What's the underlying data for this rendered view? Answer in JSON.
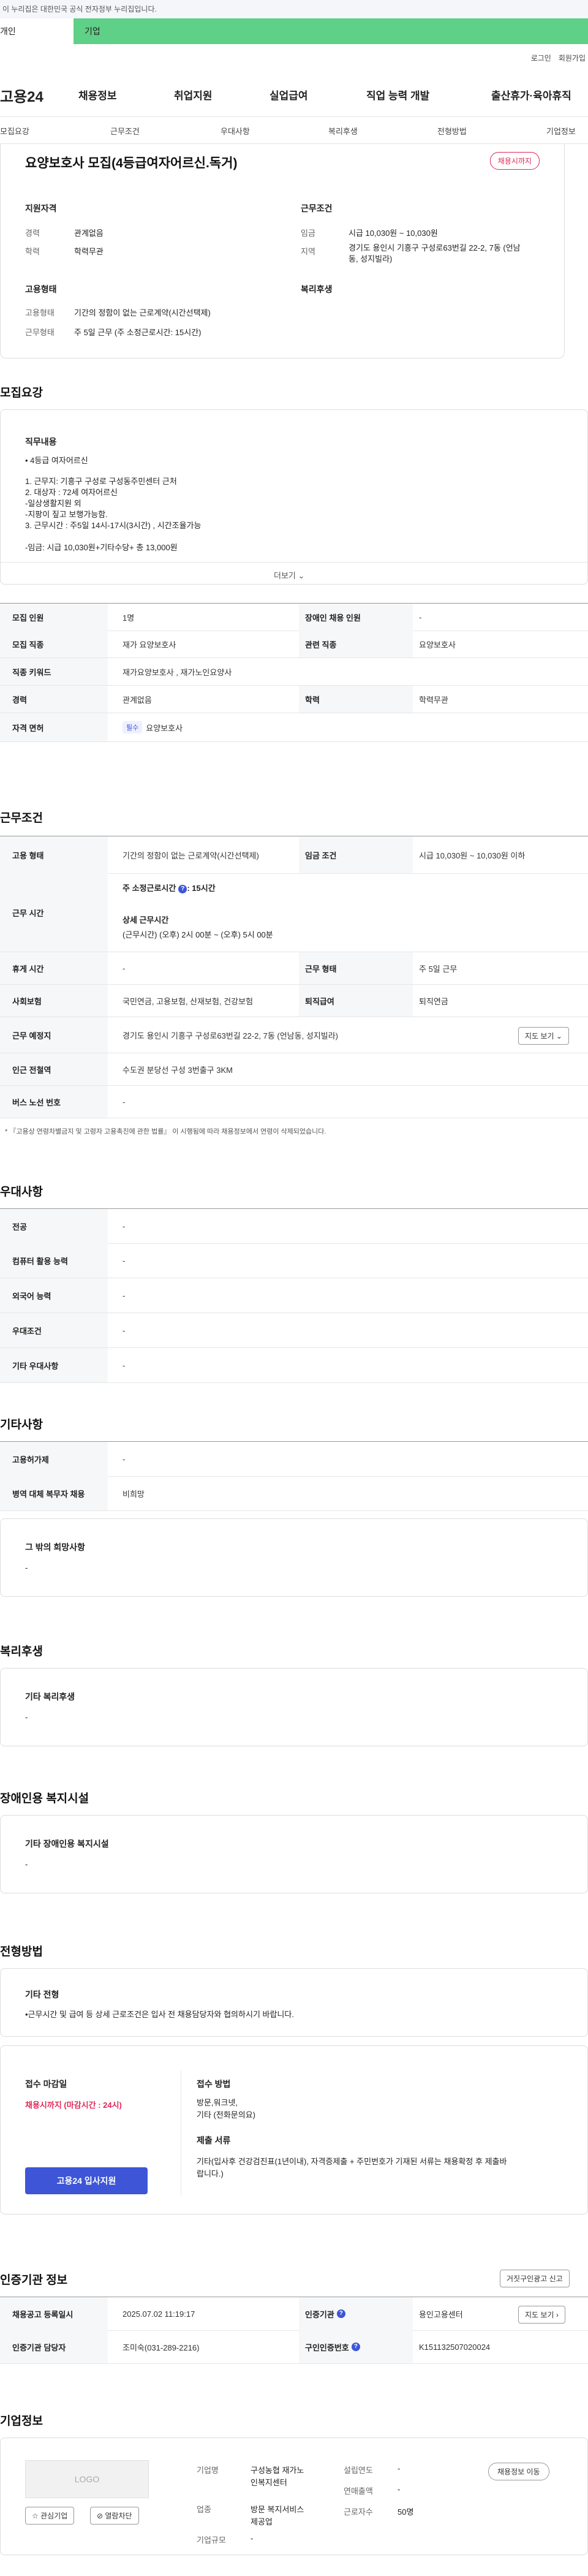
{
  "gov_bar": "이 누리집은 대한민국 공식 전자정부 누리집입니다.",
  "top_tabs": {
    "tab1": "개인",
    "tab2": "기업"
  },
  "util": {
    "login": "로그인",
    "join": "회원가입"
  },
  "logo": "고용24",
  "gnb": [
    "채용정보",
    "취업지원",
    "실업급여",
    "직업 능력 개발",
    "출산휴가·육아휴직"
  ],
  "subnav": [
    "모집요강",
    "근무조건",
    "우대사항",
    "복리후생",
    "전형방법",
    "기업정보"
  ],
  "head": {
    "title": "요양보호사 모집(4등급여자어르신.독거)",
    "badge": "채용시까지",
    "qual_label": "지원자격",
    "work_label": "근무조건",
    "career_k": "경력",
    "career_v": "관계없음",
    "edu_k": "학력",
    "edu_v": "학력무관",
    "wage_k": "임금",
    "wage_v": "시급 10,030원 ~ 10,030원",
    "loc_k": "지역",
    "loc_v1": "경기도 용인시 기흥구 구성로63번길 22-2, 7동 (언남",
    "loc_v2": "동, 성지빌라)",
    "emp_label": "고용형태",
    "welfare_label": "복리후생",
    "emp_k": "고용형태",
    "emp_v": "기간의 정함이 없는 근로계약(시간선택제)",
    "hours_k": "근무형태",
    "hours_v": "주 5일 근무 (주 소정근로시간: 15시간)"
  },
  "recruit": {
    "heading": "모집요강",
    "duty_label": "직무내용",
    "duty_lines": [
      "• 4등급 여자어르신",
      "",
      "1.  근무지: 기흥구 구성로 구성동주민센터 근처",
      "2. 대상자 : 72세 여자어르신",
      " -일상생활지원 외",
      " -지팡이 짚고 보행가능함.",
      "3. 근무시간 : 주5일  14시-17시(3시간) , 시간조율가능",
      "",
      " -임금: 시급 10,030원+기타수당+ 총 13,000원"
    ],
    "more": "더보기 ⌄",
    "rows": [
      {
        "k1": "모집 인원",
        "v1": "1명",
        "k2": "장애인 채용 인원",
        "v2": "-"
      },
      {
        "k1": "모집 직종",
        "v1": "재가 요양보호사",
        "k2": "관련 직종",
        "v2": "요양보호사"
      },
      {
        "k1": "직종 키워드",
        "v1": "재가요양보호사 , 재가노인요양사"
      },
      {
        "k1": "경력",
        "v1": "관계없음",
        "k2": "학력",
        "v2": "학력무관"
      },
      {
        "k1": "자격 면허",
        "tag": "필수",
        "v1": "요양보호사"
      }
    ]
  },
  "work": {
    "heading": "근무조건",
    "emp_k": "고용 형태",
    "emp_v": "기간의 정함이 없는 근로계약(시간선택제)",
    "wage_k": "임금 조건",
    "wage_v": "시급 10,030원 ~ 10,030원 이하",
    "time_k": "근무 시간",
    "time_v1": "주 소정근로시간",
    "time_v1b": ": 15시간",
    "time_v2": "상세 근무시간",
    "time_v3": "(근무시간) (오후) 2시 00분 ~ (오후) 5시 00분",
    "rest_k": "휴게 시간",
    "rest_v": "-",
    "type_k": "근무 형태",
    "type_v": "주 5일 근무",
    "ins_k": "사회보험",
    "ins_v": "국민연금, 고용보험, 산재보험, 건강보험",
    "ret_k": "퇴직급여",
    "ret_v": "퇴직연금",
    "addr_k": "근무 예정지",
    "addr_v": "경기도 용인시 기흥구 구성로63번길 22-2, 7동 (언남동, 성지빌라)",
    "map_btn": "지도 보기 ⌄",
    "sub_k": "인근 전철역",
    "sub_v": "수도권 분당선 구성 3번출구 3KM",
    "bus_k": "버스 노선 번호",
    "bus_v": "-",
    "note": "* 『고용상 연령차별금지 및 고령자 고용촉진에 관한 법률』 이 시행됨에 따라 채용정보에서 연령이 삭제되었습니다."
  },
  "pref": {
    "heading": "우대사항",
    "rows": [
      {
        "k": "전공",
        "v": "-"
      },
      {
        "k": "컴퓨터 활용 능력",
        "v": "-"
      },
      {
        "k": "외국어 능력",
        "v": "-"
      },
      {
        "k": "우대조건",
        "v": "-"
      },
      {
        "k": "기타 우대사항",
        "v": "-"
      }
    ]
  },
  "etc": {
    "heading": "기타사항",
    "rows": [
      {
        "k": "고용허가제",
        "v": "-"
      },
      {
        "k": "병역 대체 복무자 채용",
        "v": "비희망"
      }
    ],
    "box_title": "그 밖의 희망사항",
    "box_v": "-"
  },
  "welfare": {
    "heading": "복리후생",
    "box_title": "기타 복리후생",
    "box_v": "-"
  },
  "disabled": {
    "heading": "장애인용 복지시설",
    "box_title": "기타 장애인용 복지시설",
    "box_v": "-"
  },
  "process": {
    "heading": "전형방법",
    "other_title": "기타 전형",
    "other_v": "•근무시간 및 급여 등 상세 근로조건은 입사 전 채용담당자와 협의하시기 바랍니다.",
    "deadline_title": "접수 마감일",
    "deadline_v": "채용시까지 (마감시간 : 24시)",
    "apply_btn": "고용24 입사지원",
    "method_title": "접수 방법",
    "method_v1": "방문,워크넷,",
    "method_v2": "기타 (전화문의요)",
    "docs_title": "제출 서류",
    "docs_v1": "기타(입사후 건강검진표(1년이내), 자격증제출 + 주민번호가 기재된 서류는 채용확정 후 제출바",
    "docs_v2": "랍니다.)"
  },
  "cert": {
    "heading": "인증기관 정보",
    "report_btn": "거짓구인광고 신고",
    "reg_k": "채용공고 등록일시",
    "reg_v": "2025.07.02 11:19:17",
    "org_k": "인증기관",
    "org_v": "용인고용센터",
    "map_btn": "지도 보기 ›",
    "mgr_k": "인증기관 담당자",
    "mgr_v": "조미숙(031-289-2216)",
    "no_k": "구인인증번호",
    "no_v": "K151132507020024"
  },
  "company": {
    "heading": "기업정보",
    "logo_text": "LOGO",
    "fav_btn": "☆ 관심기업",
    "block_btn": "⊘ 열람차단",
    "name_k": "기업명",
    "name_v1": "구성농협 재가노",
    "name_v2": "인복지센터",
    "year_k": "설립연도",
    "year_v": "-",
    "sales_k": "연매출액",
    "sales_v": "-",
    "ind_k": "업종",
    "ind_v1": "방문 복지서비스",
    "ind_v2": "제공업",
    "emp_k": "근로자수",
    "emp_v": "50명",
    "size_k": "기업규모",
    "size_v": "-",
    "jobs_btn": "채용정보 이동"
  }
}
